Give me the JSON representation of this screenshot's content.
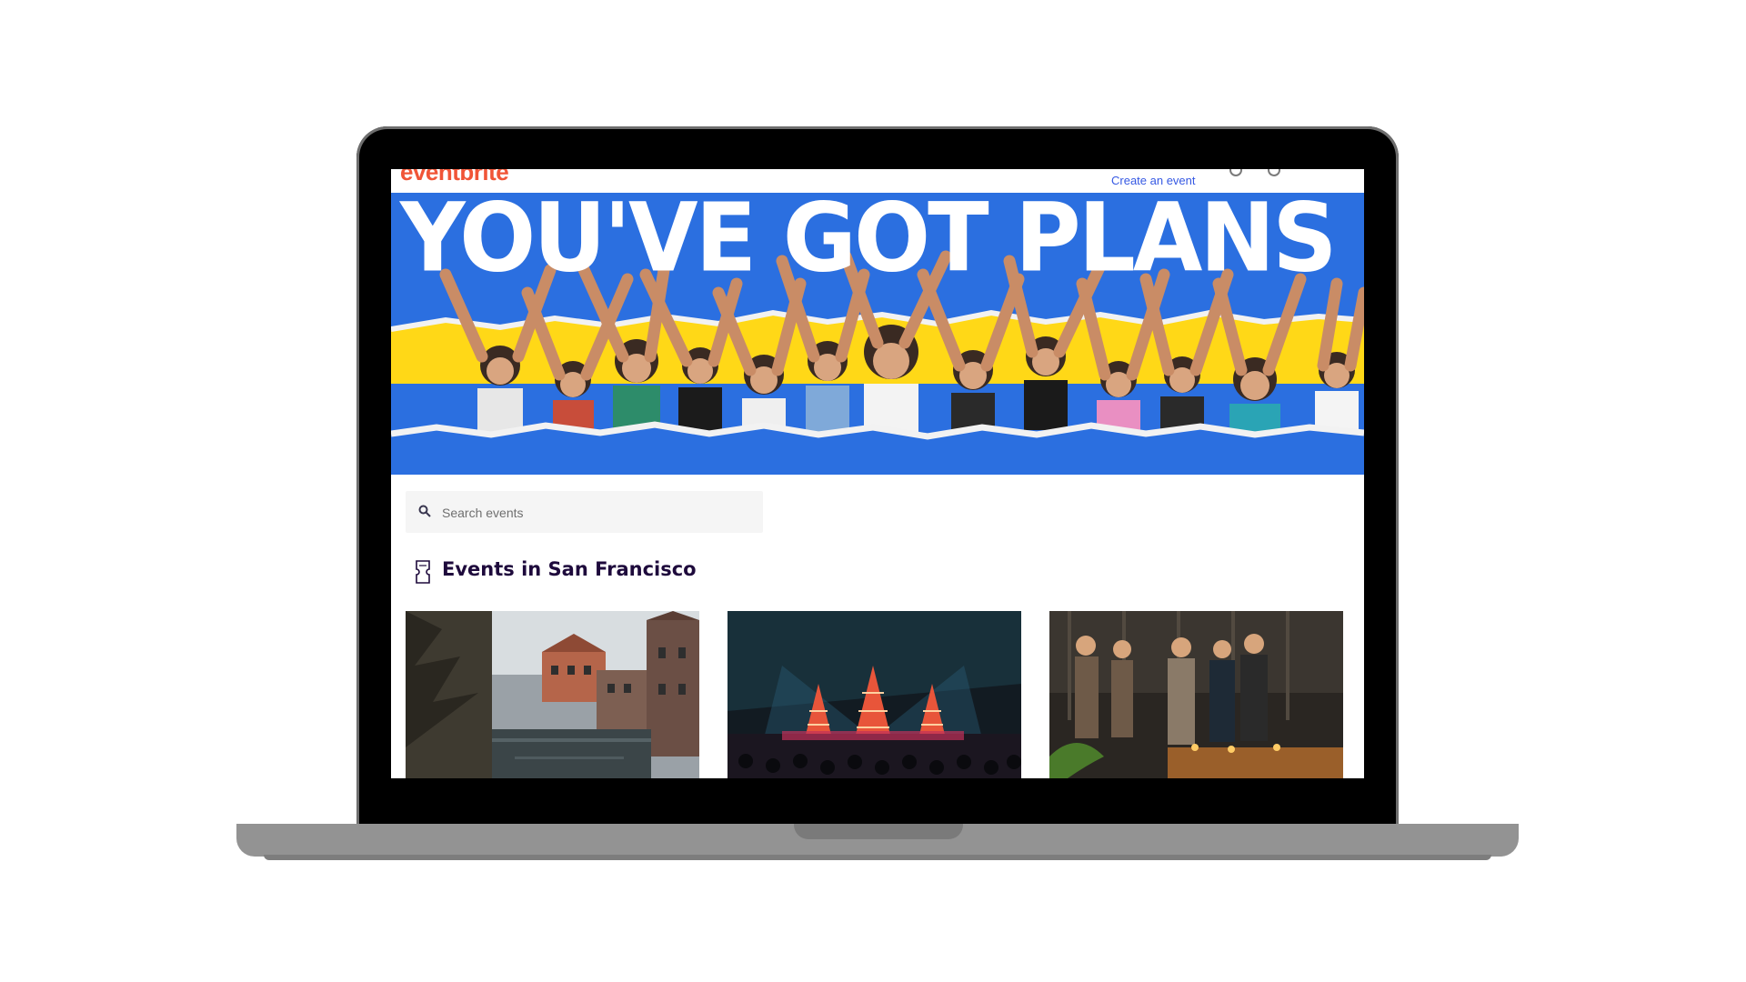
{
  "header": {
    "logo": "eventbrite",
    "create_event_label": "Create an event"
  },
  "hero": {
    "headline": "YOU'VE GOT PLANS"
  },
  "search": {
    "placeholder": "Search events"
  },
  "section": {
    "title": "Events in San Francisco"
  },
  "events": [
    {
      "image": "canal-houses-photo"
    },
    {
      "image": "festival-stage-photo"
    },
    {
      "image": "people-socializing-photo"
    }
  ],
  "colors": {
    "brand_orange": "#f05537",
    "link_blue": "#3659e3",
    "hero_blue": "#2b6fe0",
    "hero_yellow": "#ffd817",
    "heading_dark": "#1e0a3c"
  }
}
